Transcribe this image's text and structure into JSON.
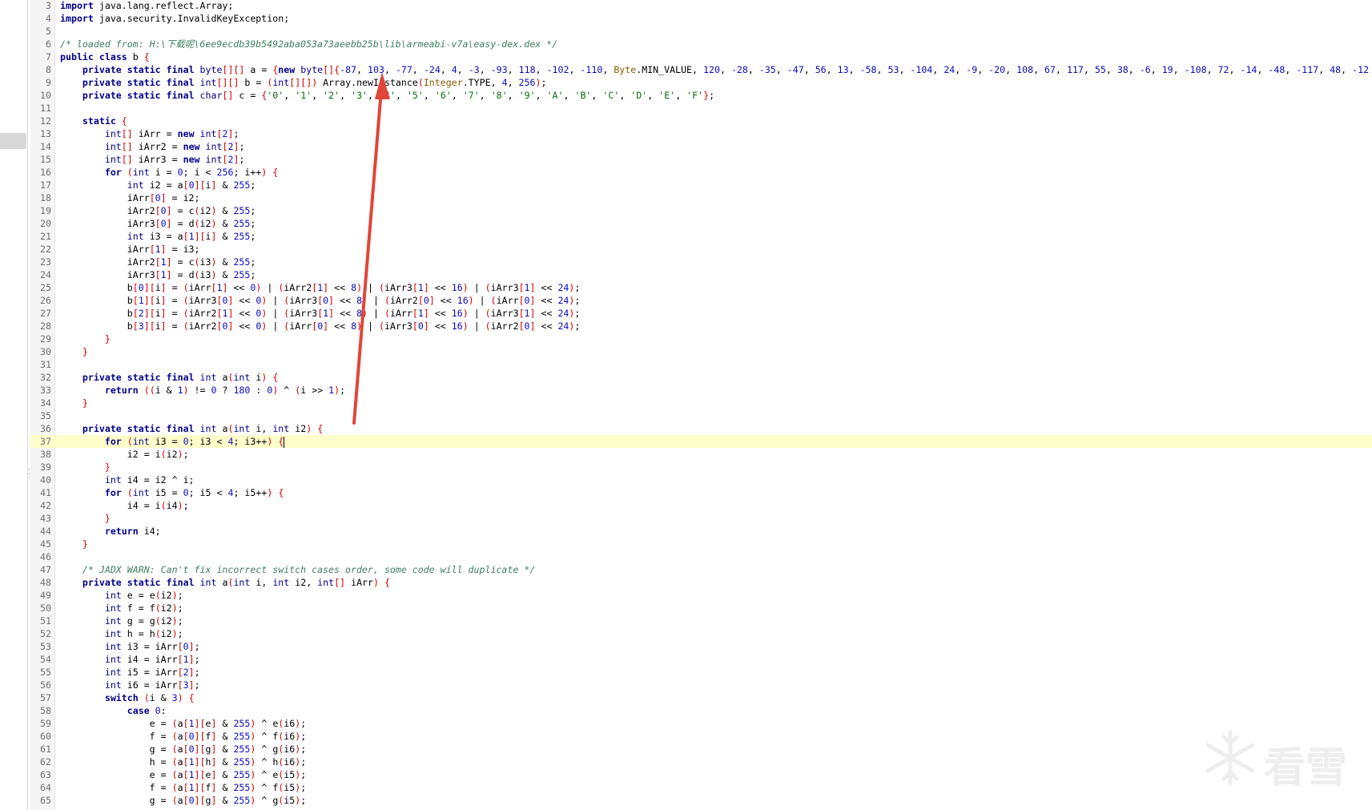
{
  "editor": {
    "lines": [
      {
        "n": "3",
        "t": "import java.lang.reflect.Array;"
      },
      {
        "n": "4",
        "t": "import java.security.InvalidKeyException;"
      },
      {
        "n": "5",
        "t": ""
      },
      {
        "n": "6",
        "t": "/* loaded from: H:\\下载呢\\6ee9ecdb39b5492aba053a73aeebb25b\\lib\\armeabi-v7a\\easy-dex.dex */"
      },
      {
        "n": "7",
        "t": "public class b {"
      },
      {
        "n": "8",
        "t": "    private static final byte[][] a = {new byte[]{-87, 103, -77, -24, 4, -3, -93, 118, -102, -110, Byte.MIN_VALUE, 120, -28, -35, -47, 56, 13, -58, 53, -104, 24, -9, -20, 108, 67, 117, 55, 38, -6, 19, -108, 72, -14, -48, -117, 48, -12"
      },
      {
        "n": "9",
        "t": "    private static final int[][] b = (int[][]) Array.newInstance(Integer.TYPE, 4, 256);"
      },
      {
        "n": "10",
        "t": "    private static final char[] c = {'0', '1', '2', '3', '4', '5', '6', '7', '8', '9', 'A', 'B', 'C', 'D', 'E', 'F'};"
      },
      {
        "n": "11",
        "t": ""
      },
      {
        "n": "12",
        "t": "    static {"
      },
      {
        "n": "13",
        "t": "        int[] iArr = new int[2];"
      },
      {
        "n": "14",
        "t": "        int[] iArr2 = new int[2];"
      },
      {
        "n": "15",
        "t": "        int[] iArr3 = new int[2];"
      },
      {
        "n": "16",
        "t": "        for (int i = 0; i < 256; i++) {"
      },
      {
        "n": "17",
        "t": "            int i2 = a[0][i] & 255;"
      },
      {
        "n": "18",
        "t": "            iArr[0] = i2;"
      },
      {
        "n": "19",
        "t": "            iArr2[0] = c(i2) & 255;"
      },
      {
        "n": "20",
        "t": "            iArr3[0] = d(i2) & 255;"
      },
      {
        "n": "21",
        "t": "            int i3 = a[1][i] & 255;"
      },
      {
        "n": "22",
        "t": "            iArr[1] = i3;"
      },
      {
        "n": "23",
        "t": "            iArr2[1] = c(i3) & 255;"
      },
      {
        "n": "24",
        "t": "            iArr3[1] = d(i3) & 255;"
      },
      {
        "n": "25",
        "t": "            b[0][i] = (iArr[1] << 0) | (iArr2[1] << 8) | (iArr3[1] << 16) | (iArr3[1] << 24);"
      },
      {
        "n": "26",
        "t": "            b[1][i] = (iArr3[0] << 0) | (iArr3[0] << 8) | (iArr2[0] << 16) | (iArr[0] << 24);"
      },
      {
        "n": "27",
        "t": "            b[2][i] = (iArr2[1] << 0) | (iArr3[1] << 8) | (iArr[1] << 16) | (iArr3[1] << 24);"
      },
      {
        "n": "28",
        "t": "            b[3][i] = (iArr2[0] << 0) | (iArr[0] << 8) | (iArr3[0] << 16) | (iArr2[0] << 24);"
      },
      {
        "n": "29",
        "t": "        }"
      },
      {
        "n": "30",
        "t": "    }"
      },
      {
        "n": "31",
        "t": ""
      },
      {
        "n": "32",
        "t": "    private static final int a(int i) {"
      },
      {
        "n": "33",
        "t": "        return ((i & 1) != 0 ? 180 : 0) ^ (i >> 1);"
      },
      {
        "n": "34",
        "t": "    }"
      },
      {
        "n": "35",
        "t": ""
      },
      {
        "n": "36",
        "t": "    private static final int a(int i, int i2) {"
      },
      {
        "n": "37",
        "t": "        for (int i3 = 0; i3 < 4; i3++) {"
      },
      {
        "n": "38",
        "t": "            i2 = i(i2);"
      },
      {
        "n": "39",
        "t": "        }"
      },
      {
        "n": "40",
        "t": "        int i4 = i2 ^ i;"
      },
      {
        "n": "41",
        "t": "        for (int i5 = 0; i5 < 4; i5++) {"
      },
      {
        "n": "42",
        "t": "            i4 = i(i4);"
      },
      {
        "n": "43",
        "t": "        }"
      },
      {
        "n": "44",
        "t": "        return i4;"
      },
      {
        "n": "45",
        "t": "    }"
      },
      {
        "n": "46",
        "t": ""
      },
      {
        "n": "47",
        "t": "    /* JADX WARN: Can't fix incorrect switch cases order, some code will duplicate */"
      },
      {
        "n": "48",
        "t": "    private static final int a(int i, int i2, int[] iArr) {"
      },
      {
        "n": "49",
        "t": "        int e = e(i2);"
      },
      {
        "n": "50",
        "t": "        int f = f(i2);"
      },
      {
        "n": "51",
        "t": "        int g = g(i2);"
      },
      {
        "n": "52",
        "t": "        int h = h(i2);"
      },
      {
        "n": "53",
        "t": "        int i3 = iArr[0];"
      },
      {
        "n": "54",
        "t": "        int i4 = iArr[1];"
      },
      {
        "n": "55",
        "t": "        int i5 = iArr[2];"
      },
      {
        "n": "56",
        "t": "        int i6 = iArr[3];"
      },
      {
        "n": "57",
        "t": "        switch (i & 3) {"
      },
      {
        "n": "58",
        "t": "            case 0:"
      },
      {
        "n": "59",
        "t": "                e = (a[1][e] & 255) ^ e(i6);"
      },
      {
        "n": "60",
        "t": "                f = (a[0][f] & 255) ^ f(i6);"
      },
      {
        "n": "61",
        "t": "                g = (a[0][g] & 255) ^ g(i6);"
      },
      {
        "n": "62",
        "t": "                h = (a[1][h] & 255) ^ h(i6);"
      },
      {
        "n": "63",
        "t": "                e = (a[1][e] & 255) ^ e(i5);"
      },
      {
        "n": "64",
        "t": "                f = (a[1][f] & 255) ^ f(i5);"
      },
      {
        "n": "65",
        "t": "                g = (a[0][g] & 255) ^ g(i5);"
      }
    ],
    "current_line": "37",
    "accent_highlight": "#ffffcc",
    "annotation_color": "#e0463a"
  },
  "watermark": {
    "icon": "snowflake-icon",
    "text": "看雪"
  }
}
